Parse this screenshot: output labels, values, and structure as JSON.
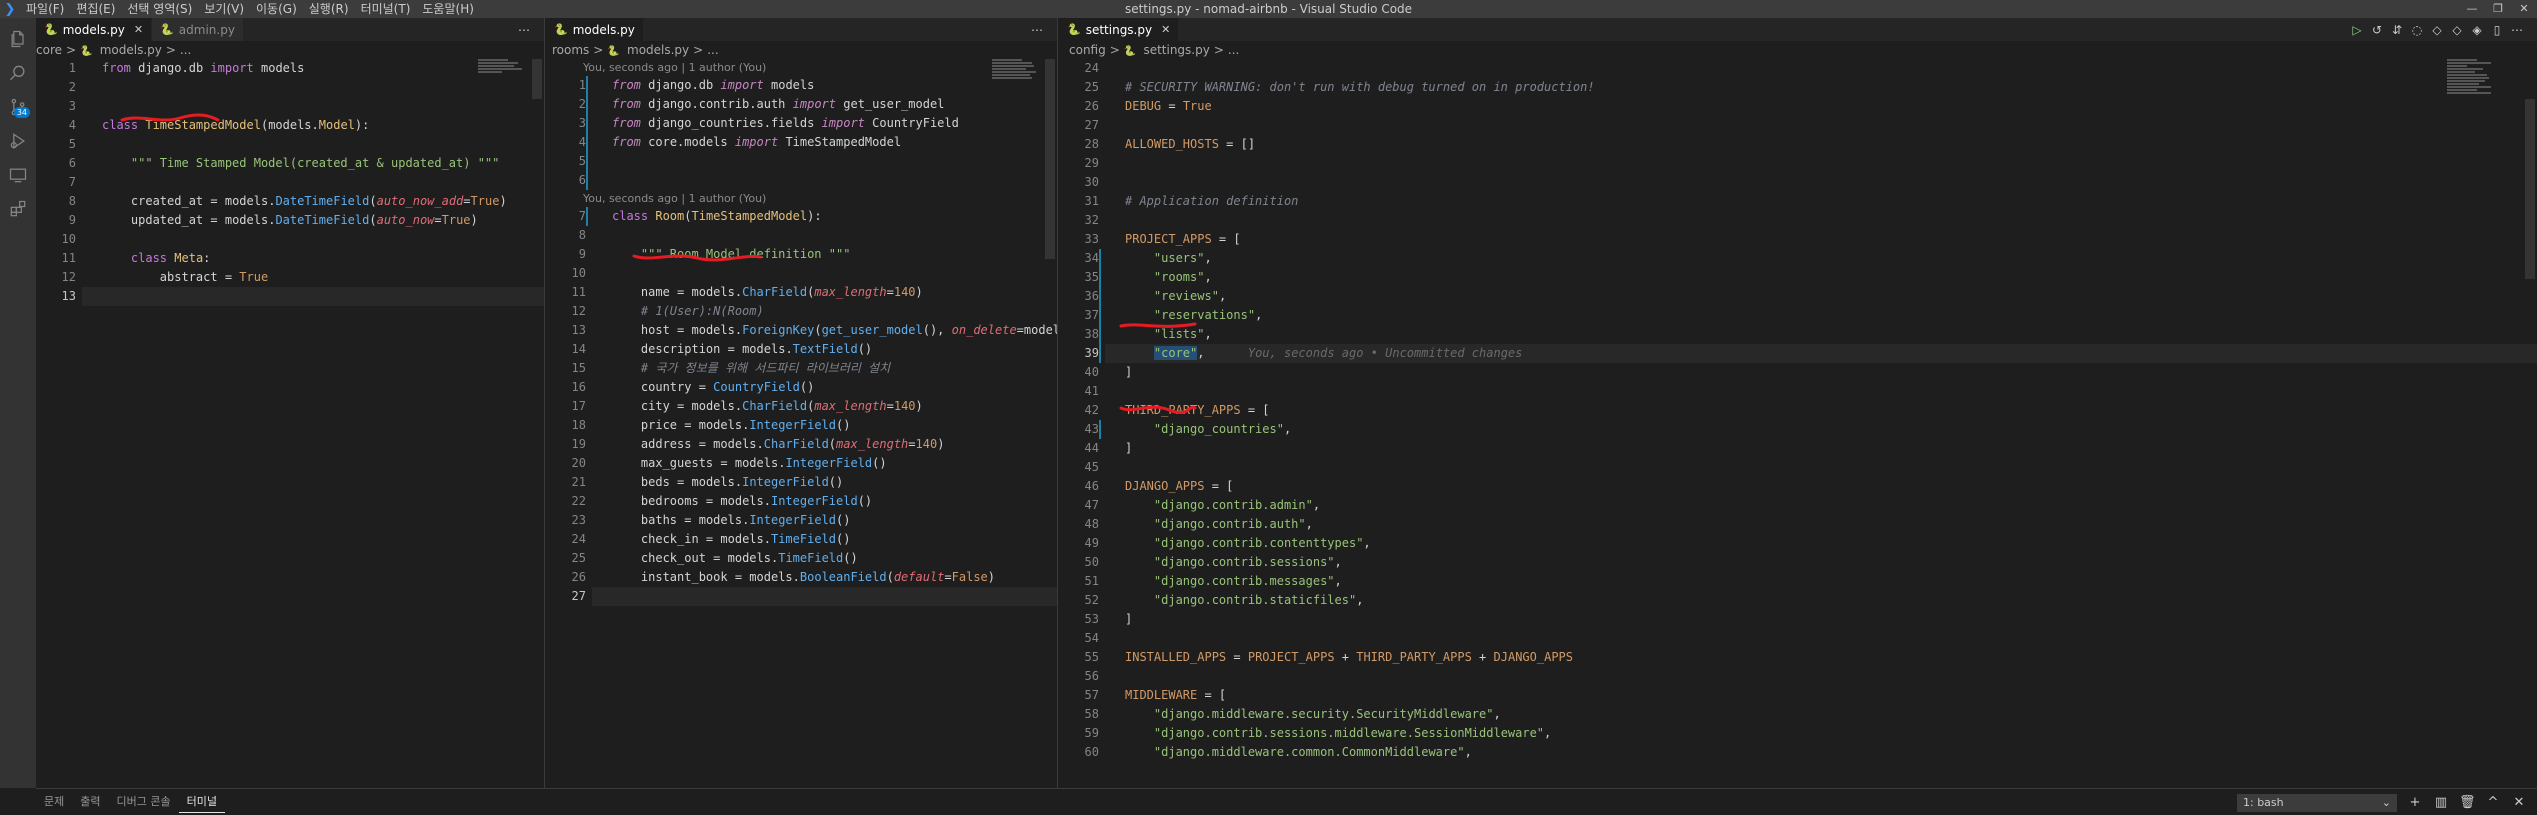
{
  "window": {
    "title": "settings.py - nomad-airbnb - Visual Studio Code",
    "menu": [
      "파일(F)",
      "편집(E)",
      "선택 영역(S)",
      "보기(V)",
      "이동(G)",
      "실행(R)",
      "터미널(T)",
      "도움말(H)"
    ],
    "controls": [
      "—",
      "❐",
      "✕"
    ]
  },
  "activity": {
    "icons": [
      "explorer-icon",
      "search-icon",
      "source-control-icon",
      "run-debug-icon",
      "remote-explorer-icon",
      "extensions-icon"
    ],
    "scm_badge": "34"
  },
  "group1": {
    "tabs": [
      {
        "label": "models.py",
        "active": true
      },
      {
        "label": "admin.py",
        "active": false
      }
    ],
    "breadcrumb": [
      "core",
      ">",
      "models.py",
      ">",
      "..."
    ],
    "lines": [
      {
        "n": "1",
        "html": "<span class='kw'>from</span> <span class='mod'>django.db</span> <span class='kw'>import</span> <span class='plain'>models</span>"
      },
      {
        "n": "2",
        "html": ""
      },
      {
        "n": "3",
        "html": ""
      },
      {
        "n": "4",
        "html": "<span class='kw'>class</span> <span class='cls'>TimeStampedModel</span>(<span class='plain'>models</span>.<span class='cls'>Model</span>):"
      },
      {
        "n": "5",
        "html": ""
      },
      {
        "n": "6",
        "html": "    <span class='str'>\"\"\" Time Stamped Model(created_at &amp; updated_at) \"\"\"</span>"
      },
      {
        "n": "7",
        "html": ""
      },
      {
        "n": "8",
        "html": "    <span class='plain'>created_at</span> = <span class='plain'>models</span>.<span class='fn'>DateTimeField</span>(<span class='param'>auto_now_add</span>=<span class='const'>True</span>)"
      },
      {
        "n": "9",
        "html": "    <span class='plain'>updated_at</span> = <span class='plain'>models</span>.<span class='fn'>DateTimeField</span>(<span class='param'>auto_now</span>=<span class='const'>True</span>)"
      },
      {
        "n": "10",
        "html": ""
      },
      {
        "n": "11",
        "html": "    <span class='kw'>class</span> <span class='cls'>Meta</span>:"
      },
      {
        "n": "12",
        "html": "        <span class='plain'>abstract</span> = <span class='const'>True</span>"
      },
      {
        "n": "13",
        "html": "",
        "current": true
      }
    ]
  },
  "group2": {
    "tabs": [
      {
        "label": "models.py",
        "active": true
      }
    ],
    "breadcrumb": [
      "rooms",
      ">",
      "models.py",
      ">",
      "..."
    ],
    "blame1": "You, seconds ago | 1 author (You)",
    "blame2": "You, seconds ago | 1 author (You)",
    "lines_a": [
      {
        "n": "1",
        "html": "<span class='kw2'>from</span> <span class='mod'>django.db</span> <span class='kw2'>import</span> <span class='plain'>models</span>"
      },
      {
        "n": "2",
        "html": "<span class='kw2'>from</span> <span class='mod'>django.contrib.auth</span> <span class='kw2'>import</span> <span class='plain'>get_user_model</span>"
      },
      {
        "n": "3",
        "html": "<span class='kw2'>from</span> <span class='mod'>django_countries.fields</span> <span class='kw2'>import</span> <span class='plain'>CountryField</span>"
      },
      {
        "n": "4",
        "html": "<span class='kw2'>from</span> <span class='mod'>core.models</span> <span class='kw2'>import</span> <span class='plain'>TimeStampedModel</span>"
      },
      {
        "n": "5",
        "html": ""
      },
      {
        "n": "6",
        "html": ""
      }
    ],
    "lines_b": [
      {
        "n": "7",
        "html": "<span class='kw'>class</span> <span class='cls'>Room</span>(<span class='cls'>TimeStampedModel</span>):"
      },
      {
        "n": "8",
        "html": ""
      },
      {
        "n": "9",
        "html": "    <span class='str'>\"\"\" Room Model definition \"\"\"</span>"
      },
      {
        "n": "10",
        "html": ""
      },
      {
        "n": "11",
        "html": "    <span class='plain'>name</span> = <span class='plain'>models</span>.<span class='fn'>CharField</span>(<span class='param'>max_length</span>=<span class='num'>140</span>)"
      },
      {
        "n": "12",
        "html": "    <span class='cmt'># 1(User):N(Room)</span>"
      },
      {
        "n": "13",
        "html": "    <span class='plain'>host</span> = <span class='plain'>models</span>.<span class='fn'>ForeignKey</span>(<span class='fn'>get_user_model</span>(), <span class='param'>on_delete</span>=<span class='plain'>models</span>.<span class='num'>CASCADE</span>)"
      },
      {
        "n": "14",
        "html": "    <span class='plain'>description</span> = <span class='plain'>models</span>.<span class='fn'>TextField</span>()"
      },
      {
        "n": "15",
        "html": "    <span class='cmt'># 국가 정보를 위해 서드파티 라이브러리 설치</span>"
      },
      {
        "n": "16",
        "html": "    <span class='plain'>country</span> = <span class='fn'>CountryField</span>()"
      },
      {
        "n": "17",
        "html": "    <span class='plain'>city</span> = <span class='plain'>models</span>.<span class='fn'>CharField</span>(<span class='param'>max_length</span>=<span class='num'>140</span>)"
      },
      {
        "n": "18",
        "html": "    <span class='plain'>price</span> = <span class='plain'>models</span>.<span class='fn'>IntegerField</span>()"
      },
      {
        "n": "19",
        "html": "    <span class='plain'>address</span> = <span class='plain'>models</span>.<span class='fn'>CharField</span>(<span class='param'>max_length</span>=<span class='num'>140</span>)"
      },
      {
        "n": "20",
        "html": "    <span class='plain'>max_guests</span> = <span class='plain'>models</span>.<span class='fn'>IntegerField</span>()"
      },
      {
        "n": "21",
        "html": "    <span class='plain'>beds</span> = <span class='plain'>models</span>.<span class='fn'>IntegerField</span>()"
      },
      {
        "n": "22",
        "html": "    <span class='plain'>bedrooms</span> = <span class='plain'>models</span>.<span class='fn'>IntegerField</span>()"
      },
      {
        "n": "23",
        "html": "    <span class='plain'>baths</span> = <span class='plain'>models</span>.<span class='fn'>IntegerField</span>()"
      },
      {
        "n": "24",
        "html": "    <span class='plain'>check_in</span> = <span class='plain'>models</span>.<span class='fn'>TimeField</span>()"
      },
      {
        "n": "25",
        "html": "    <span class='plain'>check_out</span> = <span class='plain'>models</span>.<span class='fn'>TimeField</span>()"
      },
      {
        "n": "26",
        "html": "    <span class='plain'>instant_book</span> = <span class='plain'>models</span>.<span class='fn'>BooleanField</span>(<span class='param'>default</span>=<span class='const'>False</span>)"
      },
      {
        "n": "27",
        "html": "",
        "current": true
      }
    ]
  },
  "group3": {
    "tabs": [
      {
        "label": "settings.py",
        "active": true
      }
    ],
    "actions": [
      "▷",
      "↺",
      "⇵",
      "◌",
      "◇",
      "◇",
      "◈",
      "▯",
      "⋯"
    ],
    "breadcrumb": [
      "config",
      ">",
      "settings.py",
      ">",
      "..."
    ],
    "lines": [
      {
        "n": "24",
        "html": ""
      },
      {
        "n": "25",
        "html": "<span class='cmt'># SECURITY WARNING: don't run with debug turned on in production!</span>"
      },
      {
        "n": "26",
        "html": "<span class='num'>DEBUG</span> = <span class='const'>True</span>"
      },
      {
        "n": "27",
        "html": ""
      },
      {
        "n": "28",
        "html": "<span class='num'>ALLOWED_HOSTS</span> = []"
      },
      {
        "n": "29",
        "html": ""
      },
      {
        "n": "30",
        "html": ""
      },
      {
        "n": "31",
        "html": "<span class='cmt'># Application definition</span>"
      },
      {
        "n": "32",
        "html": ""
      },
      {
        "n": "33",
        "html": "<span class='num'>PROJECT_APPS</span> = ["
      },
      {
        "n": "34",
        "html": "    <span class='str'>\"users\"</span>,"
      },
      {
        "n": "35",
        "html": "    <span class='str'>\"rooms\"</span>,"
      },
      {
        "n": "36",
        "html": "    <span class='str'>\"reviews\"</span>,"
      },
      {
        "n": "37",
        "html": "    <span class='str'>\"reservations\"</span>,"
      },
      {
        "n": "38",
        "html": "    <span class='str'>\"lists\"</span>,"
      },
      {
        "n": "39",
        "html": "    <span class='str sel-hl'>\"core\"</span>,",
        "current": true,
        "ghost": "You, seconds ago • Uncommitted changes"
      },
      {
        "n": "40",
        "html": "]"
      },
      {
        "n": "41",
        "html": ""
      },
      {
        "n": "42",
        "html": "<span class='num'>THIRD_PARTY_APPS</span> = ["
      },
      {
        "n": "43",
        "html": "    <span class='str'>\"django_countries\"</span>,"
      },
      {
        "n": "44",
        "html": "]"
      },
      {
        "n": "45",
        "html": ""
      },
      {
        "n": "46",
        "html": "<span class='num'>DJANGO_APPS</span> = ["
      },
      {
        "n": "47",
        "html": "    <span class='str'>\"django.contrib.admin\"</span>,"
      },
      {
        "n": "48",
        "html": "    <span class='str'>\"django.contrib.auth\"</span>,"
      },
      {
        "n": "49",
        "html": "    <span class='str'>\"django.contrib.contenttypes\"</span>,"
      },
      {
        "n": "50",
        "html": "    <span class='str'>\"django.contrib.sessions\"</span>,"
      },
      {
        "n": "51",
        "html": "    <span class='str'>\"django.contrib.messages\"</span>,"
      },
      {
        "n": "52",
        "html": "    <span class='str'>\"django.contrib.staticfiles\"</span>,"
      },
      {
        "n": "53",
        "html": "]"
      },
      {
        "n": "54",
        "html": ""
      },
      {
        "n": "55",
        "html": "<span class='num'>INSTALLED_APPS</span> = <span class='num'>PROJECT_APPS</span> + <span class='num'>THIRD_PARTY_APPS</span> + <span class='num'>DJANGO_APPS</span>"
      },
      {
        "n": "56",
        "html": ""
      },
      {
        "n": "57",
        "html": "<span class='num'>MIDDLEWARE</span> = ["
      },
      {
        "n": "58",
        "html": "    <span class='str'>\"django.middleware.security.SecurityMiddleware\"</span>,"
      },
      {
        "n": "59",
        "html": "    <span class='str'>\"django.contrib.sessions.middleware.SessionMiddleware\"</span>,"
      },
      {
        "n": "60",
        "html": "    <span class='str'>\"django.middleware.common.CommonMiddleware\"</span>,"
      }
    ]
  },
  "panel": {
    "tabs": [
      "문제",
      "출력",
      "디버그 콘솔",
      "터미널"
    ],
    "active_tab": "터미널",
    "terminal_select": "1: bash",
    "icons": [
      "+",
      "▥",
      "🗑",
      "^",
      "✕"
    ]
  }
}
